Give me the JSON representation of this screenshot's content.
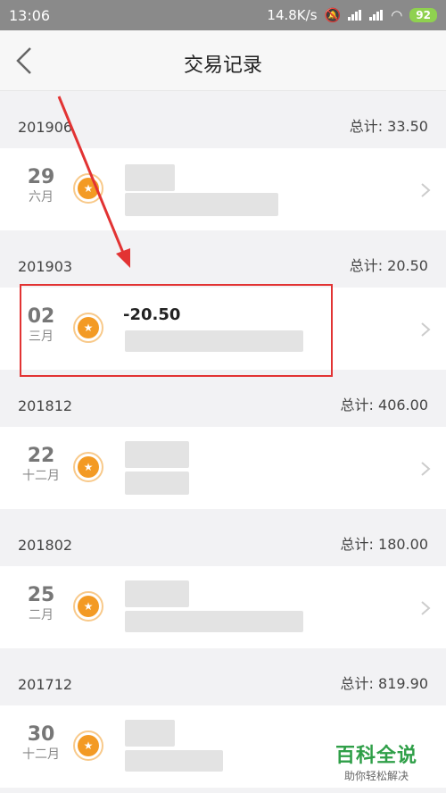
{
  "status": {
    "time": "13:06",
    "speed": "14.8K/s",
    "battery": "92"
  },
  "nav": {
    "title": "交易记录"
  },
  "months": [
    {
      "label": "201906",
      "total": "总计: 33.50",
      "day": "29",
      "month": "六月"
    },
    {
      "label": "201903",
      "total": "总计: 20.50",
      "day": "02",
      "month": "三月",
      "amount": "-20.50"
    },
    {
      "label": "201812",
      "total": "总计: 406.00",
      "day": "22",
      "month": "十二月"
    },
    {
      "label": "201802",
      "total": "总计: 180.00",
      "day": "25",
      "month": "二月"
    },
    {
      "label": "201712",
      "total": "总计: 819.90",
      "day": "30",
      "month": "十二月"
    }
  ],
  "watermark": {
    "title": "百科全说",
    "subtitle": "助你轻松解决"
  },
  "colors": {
    "accent": "#f39a24",
    "highlight": "#e23333"
  }
}
